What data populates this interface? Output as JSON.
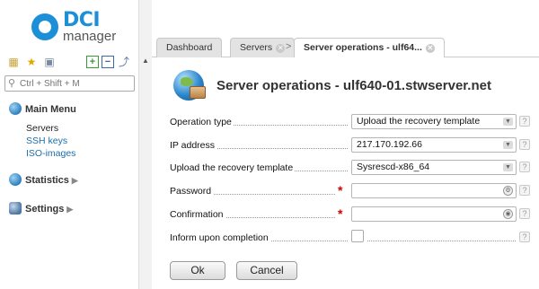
{
  "brand": {
    "name_top": "DCI",
    "name_bottom": "manager"
  },
  "sidebar": {
    "search_placeholder": "Ctrl + Shift + M",
    "toolbar_icons": [
      "tree-view-icon",
      "favorites-star-icon",
      "briefcase-icon",
      "expand-plus-icon",
      "collapse-minus-icon",
      "pin-icon"
    ],
    "main_menu": {
      "label": "Main Menu",
      "items": [
        "Servers",
        "SSH keys",
        "ISO-images"
      ],
      "active": "Servers"
    },
    "statistics": {
      "label": "Statistics"
    },
    "settings": {
      "label": "Settings"
    }
  },
  "tabs": [
    {
      "label": "Dashboard",
      "closable": false,
      "active": false
    },
    {
      "label": "Servers",
      "closable": true,
      "active": false
    },
    {
      "label": "Server operations - ulf64...",
      "closable": true,
      "active": true
    }
  ],
  "form": {
    "title": "Server operations - ulf640-01.stwserver.net",
    "fields": {
      "operation_type": {
        "label": "Operation type",
        "value": "Upload the recovery template",
        "type": "select"
      },
      "ip_address": {
        "label": "IP address",
        "value": "217.170.192.66",
        "type": "select"
      },
      "recovery_template": {
        "label": "Upload the recovery template",
        "value": "Sysrescd-x86_64",
        "type": "select"
      },
      "password": {
        "label": "Password",
        "value": "",
        "required": true,
        "type": "password"
      },
      "confirmation": {
        "label": "Confirmation",
        "value": "",
        "required": true,
        "type": "password"
      },
      "inform": {
        "label": "Inform upon completion",
        "checked": false,
        "type": "checkbox"
      }
    },
    "required_mark": "*",
    "help_mark": "?",
    "buttons": {
      "ok": "Ok",
      "cancel": "Cancel"
    }
  },
  "colors": {
    "brand_blue": "#1b8fd8",
    "required_red": "#d40000",
    "link_blue": "#1b6ea9"
  }
}
